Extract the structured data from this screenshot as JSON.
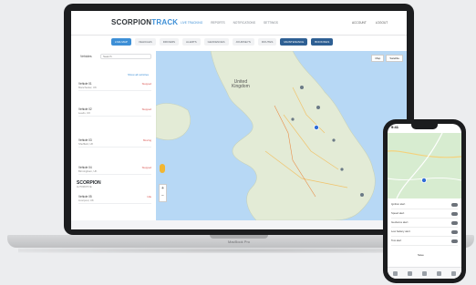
{
  "laptop": {
    "brand_label": "MacBook Pro",
    "app": {
      "logo_main": "SCORPION",
      "logo_accent": "TRACK",
      "top_nav": [
        "LIVE TRACKING",
        "REPORTS",
        "NOTIFICATIONS",
        "SETTINGS"
      ],
      "top_right": [
        "ACCOUNT",
        "LOGOUT"
      ],
      "sub_nav": [
        "LIVE MAP",
        "VEHICLES",
        "DRIVERS",
        "ALERTS",
        "GEOFENCES",
        "JOURNEYS",
        "ROUTES",
        "MAINTENANCE",
        "BOOKINGS"
      ],
      "sidebar": {
        "heading": "Vehicles",
        "search_placeholder": "Search",
        "link": "Show all vehicles",
        "vehicles": [
          {
            "title": "Vehicle 01",
            "location": "Manchester, UK",
            "status": "Stopped"
          },
          {
            "title": "Vehicle 02",
            "location": "Leeds, UK",
            "status": "Stopped"
          },
          {
            "title": "Vehicle 03",
            "location": "Sheffield, UK",
            "status": "Moving"
          },
          {
            "title": "Vehicle 04",
            "location": "Birmingham, UK",
            "status": "Stopped"
          },
          {
            "title": "Vehicle 05",
            "location": "Liverpool, UK",
            "status": "Idle"
          }
        ],
        "footer_logo": "SCORPION",
        "footer_sub": "AUTOMOTIVE"
      },
      "map": {
        "country_label_1": "United",
        "country_label_2": "Kingdom",
        "buttons": [
          "Map",
          "Satellite"
        ],
        "zoom_in": "+",
        "zoom_out": "−"
      }
    }
  },
  "phone": {
    "time": "9:41",
    "rows": [
      "Ignition alert",
      "Speed alert",
      "Geofence alert",
      "Low battery alert",
      "Tow alert"
    ],
    "ok_label": "Save"
  }
}
